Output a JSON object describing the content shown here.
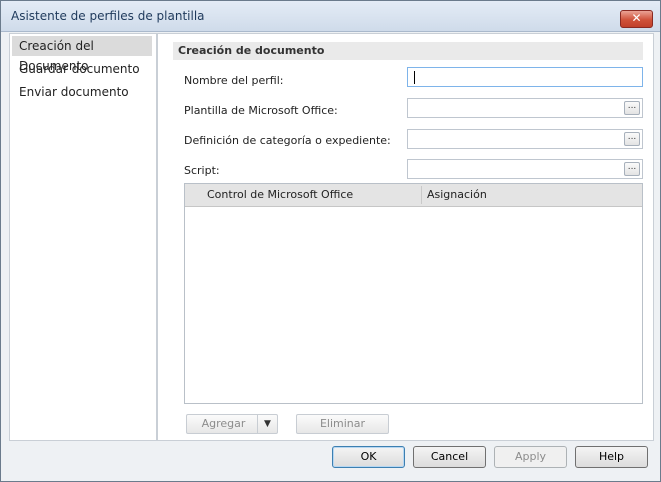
{
  "window": {
    "title": "Asistente de perfiles de plantilla",
    "close_glyph": "✕"
  },
  "sidebar": {
    "items": [
      {
        "label": "Creación del Documento",
        "selected": true
      },
      {
        "label": "Guardar documento",
        "selected": false
      },
      {
        "label": "Enviar documento",
        "selected": false
      }
    ]
  },
  "main": {
    "section_title": "Creación de documento",
    "fields": [
      {
        "label": "Nombre del perfil:",
        "value": ""
      },
      {
        "label": "Plantilla de Microsoft Office:",
        "value": "",
        "browse": "..."
      },
      {
        "label": "Definición de categoría o expediente:",
        "value": "",
        "browse": "..."
      },
      {
        "label": "Script:",
        "value": "",
        "browse": "..."
      }
    ],
    "table": {
      "columns": [
        "Control de Microsoft Office",
        "Asignación"
      ],
      "rows": []
    },
    "buttons": {
      "add": "Agregar",
      "add_arrow": "▼",
      "remove": "Eliminar"
    }
  },
  "footer": {
    "ok": "OK",
    "cancel": "Cancel",
    "apply": "Apply",
    "help": "Help"
  },
  "colors": {
    "title_text": "#1e395b",
    "close_red": "#d0523a",
    "selected_bg": "#dbdbdb"
  }
}
